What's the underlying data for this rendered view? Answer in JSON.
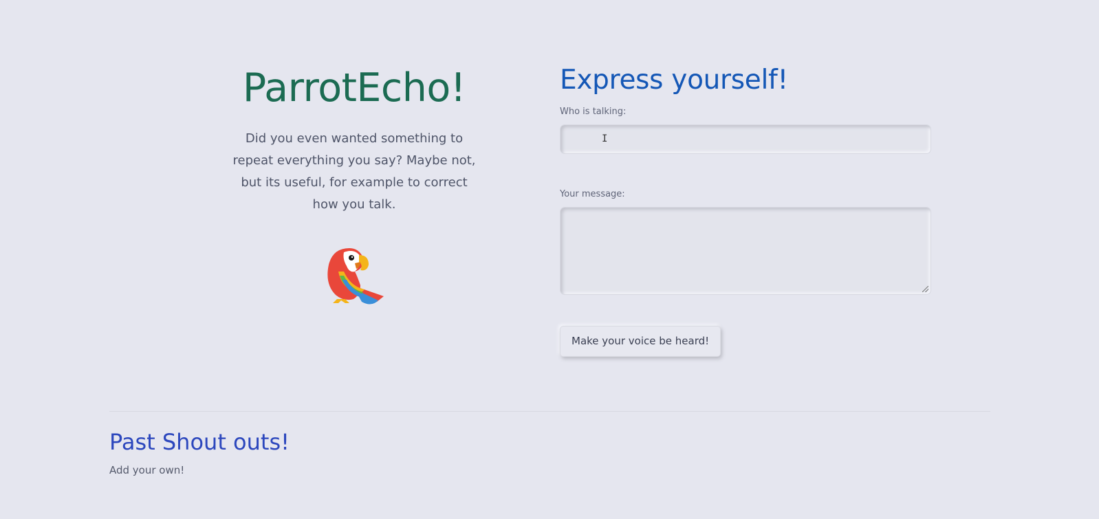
{
  "hero": {
    "title": "ParrotEcho!",
    "description": "Did you even wanted something to repeat everything you say? Maybe not, but its useful, for example to correct how you talk.",
    "mascot_icon": "parrot-icon"
  },
  "form": {
    "title": "Express yourself!",
    "name_label": "Who is talking:",
    "name_value": "",
    "message_label": "Your message:",
    "message_value": "",
    "submit_label": "Make your voice be heard!"
  },
  "past": {
    "title": "Past Shout outs!",
    "subtitle": "Add your own!"
  },
  "colors": {
    "background": "#e5e6ef",
    "brand_title": "#1b6b52",
    "form_title": "#1457b6",
    "past_title": "#2c47bd"
  }
}
